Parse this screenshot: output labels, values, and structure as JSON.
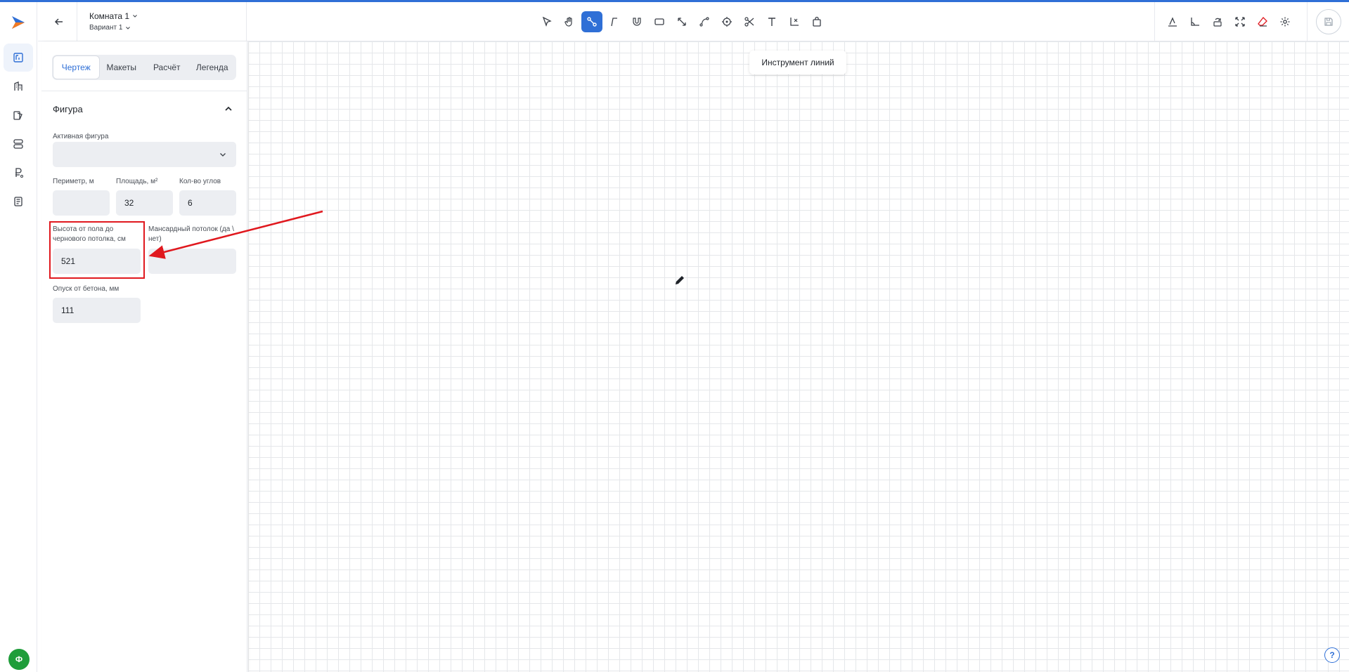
{
  "header": {
    "room_title": "Комната 1",
    "variant_title": "Вариант 1"
  },
  "toolbar": {
    "tools": [
      "select-icon",
      "hand-icon",
      "line-tool-icon",
      "wall-icon",
      "magnet-icon",
      "rectangle-icon",
      "diagonal-icon",
      "curve-icon",
      "target-icon",
      "scissors-icon",
      "text-icon",
      "axis-icon",
      "bag-icon"
    ],
    "active_tool": "line-tool-icon",
    "right_tools": [
      "text-angle-icon",
      "angle-icon",
      "rotate-icon",
      "expand-icon",
      "eraser-icon",
      "gear-icon"
    ]
  },
  "rail": {
    "items": [
      "drawing-icon",
      "building-icon",
      "materials-icon",
      "layers-icon",
      "price-icon",
      "report-icon"
    ],
    "avatar_letter": "Ф"
  },
  "panel": {
    "tabs": [
      {
        "label": "Чертеж",
        "active": true
      },
      {
        "label": "Макеты",
        "active": false
      },
      {
        "label": "Расчёт",
        "active": false
      },
      {
        "label": "Легенда",
        "active": false
      }
    ],
    "section_title": "Фигура",
    "active_shape_label": "Активная фигура",
    "active_shape_value": "",
    "perimeter_label": "Периметр, м",
    "perimeter_value": "",
    "area_label": "Площадь, м²",
    "area_value": "32",
    "corners_label": "Кол-во углов",
    "corners_value": "6",
    "height_label": "Высота от пола до чернового потолка, см",
    "height_value": "521",
    "attic_label": "Мансардный потолок (да \\ нет)",
    "attic_value": "",
    "drop_label": "Опуск от бетона, мм",
    "drop_value": "111"
  },
  "canvas": {
    "tool_hint": "Инструмент линий"
  },
  "colors": {
    "accent": "#2f6fd6",
    "annotation": "#e0181e",
    "avatar": "#1f9d3a"
  }
}
